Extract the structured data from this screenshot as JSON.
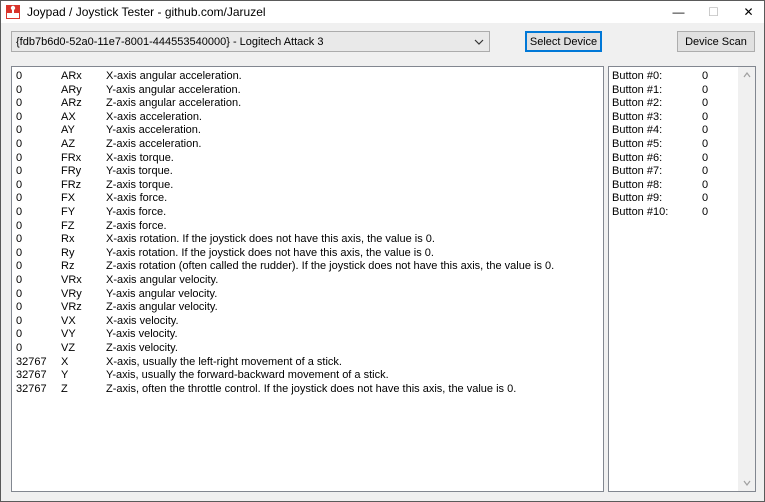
{
  "window": {
    "title": "Joypad / Joystick Tester - github.com/Jaruzel",
    "minimize_glyph": "—",
    "maximize_glyph": "☐",
    "close_glyph": "✕"
  },
  "toolbar": {
    "device_select_value": "{fdb7b6d0-52a0-11e7-8001-444553540000} - Logitech Attack 3",
    "select_device_label": "Select Device",
    "device_scan_label": "Device Scan"
  },
  "axes": [
    {
      "value": "0",
      "name": "ARx",
      "desc": "X-axis angular acceleration."
    },
    {
      "value": "0",
      "name": "ARy",
      "desc": "Y-axis angular acceleration."
    },
    {
      "value": "0",
      "name": "ARz",
      "desc": "Z-axis angular acceleration."
    },
    {
      "value": "0",
      "name": "AX",
      "desc": "X-axis acceleration."
    },
    {
      "value": "0",
      "name": "AY",
      "desc": "Y-axis acceleration."
    },
    {
      "value": "0",
      "name": "AZ",
      "desc": "Z-axis acceleration."
    },
    {
      "value": "0",
      "name": "FRx",
      "desc": "X-axis torque."
    },
    {
      "value": "0",
      "name": "FRy",
      "desc": "Y-axis torque."
    },
    {
      "value": "0",
      "name": "FRz",
      "desc": "Z-axis torque."
    },
    {
      "value": "0",
      "name": "FX",
      "desc": "X-axis force."
    },
    {
      "value": "0",
      "name": "FY",
      "desc": "Y-axis force."
    },
    {
      "value": "0",
      "name": "FZ",
      "desc": "Z-axis force."
    },
    {
      "value": "0",
      "name": "Rx",
      "desc": "X-axis rotation. If the joystick does not have this axis, the value is 0."
    },
    {
      "value": "0",
      "name": "Ry",
      "desc": "Y-axis rotation. If the joystick does not have this axis, the value is 0."
    },
    {
      "value": "0",
      "name": "Rz",
      "desc": "Z-axis rotation (often called the rudder). If the joystick does not have this axis, the value is 0."
    },
    {
      "value": "0",
      "name": "VRx",
      "desc": "X-axis angular velocity."
    },
    {
      "value": "0",
      "name": "VRy",
      "desc": "Y-axis angular velocity."
    },
    {
      "value": "0",
      "name": "VRz",
      "desc": "Z-axis angular velocity."
    },
    {
      "value": "0",
      "name": "VX",
      "desc": "X-axis velocity."
    },
    {
      "value": "0",
      "name": "VY",
      "desc": "Y-axis velocity."
    },
    {
      "value": "0",
      "name": "VZ",
      "desc": "Z-axis velocity."
    },
    {
      "value": "32767",
      "name": "X",
      "desc": "X-axis, usually the left-right movement of a stick."
    },
    {
      "value": "32767",
      "name": "Y",
      "desc": "Y-axis, usually the forward-backward movement of a stick."
    },
    {
      "value": "32767",
      "name": "Z",
      "desc": "Z-axis, often the throttle control. If the joystick does not have this axis, the value is 0."
    }
  ],
  "buttons": [
    {
      "name": "Button #0:",
      "value": "0"
    },
    {
      "name": "Button #1:",
      "value": "0"
    },
    {
      "name": "Button #2:",
      "value": "0"
    },
    {
      "name": "Button #3:",
      "value": "0"
    },
    {
      "name": "Button #4:",
      "value": "0"
    },
    {
      "name": "Button #5:",
      "value": "0"
    },
    {
      "name": "Button #6:",
      "value": "0"
    },
    {
      "name": "Button #7:",
      "value": "0"
    },
    {
      "name": "Button #8:",
      "value": "0"
    },
    {
      "name": "Button #9:",
      "value": "0"
    },
    {
      "name": "Button #10:",
      "value": "0"
    }
  ],
  "icons": {
    "app": "joystick-icon",
    "dropdown": "chevron-down-icon",
    "scroll_up": "chevron-up-icon",
    "scroll_down": "chevron-down-icon"
  },
  "colors": {
    "focus_border": "#0078d7",
    "app_icon_red": "#d9342b"
  }
}
